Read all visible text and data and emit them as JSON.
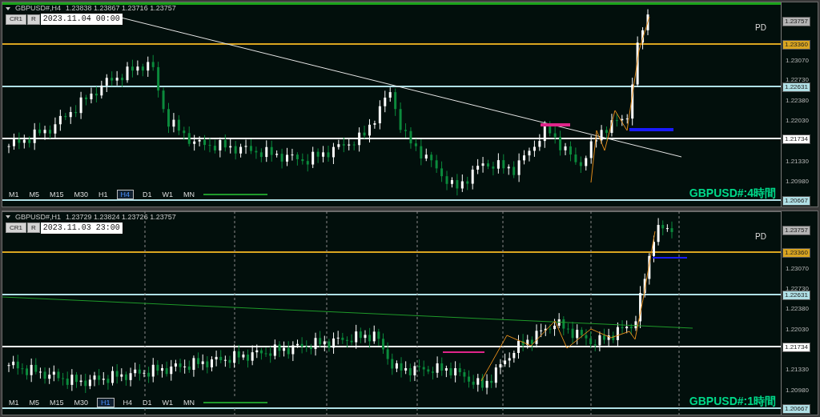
{
  "panels": [
    {
      "active": true,
      "symbol": "GBPUSD#,H4",
      "ohlc": "1.23838 1.23867 1.23716 1.23757",
      "buttons": [
        "CR1",
        "R"
      ],
      "datetime": "2023.11.04 00:00",
      "marker_label": "PD",
      "caption": "GBPUSD#:4時間",
      "axis_ticks": [
        "1.23070",
        "1.22730",
        "1.22380",
        "1.22030",
        "1.21330",
        "1.20980"
      ],
      "levels": [
        {
          "price": "1.23757",
          "color": "#b4b4b4",
          "line": false
        },
        {
          "price": "1.23360",
          "color": "#daa520",
          "line": true
        },
        {
          "price": "1.22631",
          "color": "#b0e0e6",
          "line": true
        },
        {
          "price": "1.21734",
          "color": "#ffffff",
          "line": true
        },
        {
          "price": "1.20667",
          "color": "#b0e0e6",
          "line": true
        }
      ],
      "timeframes": [
        {
          "label": "M1",
          "selected": false
        },
        {
          "label": "M5",
          "selected": false
        },
        {
          "label": "M15",
          "selected": false
        },
        {
          "label": "M30",
          "selected": false
        },
        {
          "label": "H1",
          "selected": false
        },
        {
          "label": "H4",
          "selected": true
        },
        {
          "label": "D1",
          "selected": false
        },
        {
          "label": "W1",
          "selected": false
        },
        {
          "label": "MN",
          "selected": false
        }
      ]
    },
    {
      "active": false,
      "symbol": "GBPUSD#,H1",
      "ohlc": "1.23729 1.23824 1.23726 1.23757",
      "buttons": [
        "CR1",
        "R"
      ],
      "datetime": "2023.11.03 23:00",
      "marker_label": "PD",
      "caption": "GBPUSD#:1時間",
      "axis_ticks": [
        "1.23070",
        "1.22730",
        "1.22380",
        "1.22030",
        "1.21330",
        "1.20980"
      ],
      "levels": [
        {
          "price": "1.23757",
          "color": "#b4b4b4",
          "line": false
        },
        {
          "price": "1.23360",
          "color": "#daa520",
          "line": true
        },
        {
          "price": "1.22631",
          "color": "#b0e0e6",
          "line": true
        },
        {
          "price": "1.21734",
          "color": "#ffffff",
          "line": true
        },
        {
          "price": "1.20667",
          "color": "#b0e0e6",
          "line": true
        }
      ],
      "timeframes": [
        {
          "label": "M1",
          "selected": false
        },
        {
          "label": "M5",
          "selected": false
        },
        {
          "label": "M15",
          "selected": false
        },
        {
          "label": "M30",
          "selected": false
        },
        {
          "label": "H1",
          "selected": true
        },
        {
          "label": "H4",
          "selected": false
        },
        {
          "label": "D1",
          "selected": false
        },
        {
          "label": "W1",
          "selected": false
        },
        {
          "label": "MN",
          "selected": false
        }
      ]
    }
  ]
}
